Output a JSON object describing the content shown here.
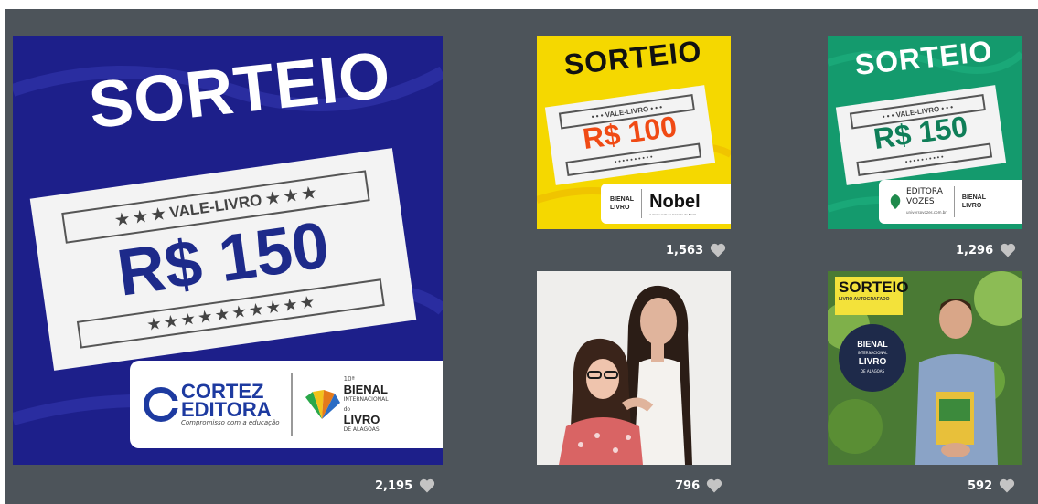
{
  "posts": [
    {
      "sorteio": "SORTEIO",
      "vale": "★ ★ ★ VALE-LIVRO ★ ★ ★",
      "amount": "R$ 150",
      "stars": "★ ★ ★ ★ ★ ★ ★ ★ ★ ★",
      "logo1_line1": "CORTEZ",
      "logo1_line2": "EDITORA",
      "logo1_tagline": "Compromisso com a educação",
      "logo2_small": "10ª",
      "logo2_line1": "BIENAL",
      "logo2_line2": "INTERNACIONAL",
      "logo2_line3": "do",
      "logo2_line4": "LIVRO",
      "logo2_line5": "DE ALAGOAS",
      "likes": "2,195"
    },
    {
      "sorteio": "SORTEIO",
      "vale": "• • • VALE-LIVRO • • •",
      "amount": "R$ 100",
      "stars": "• • • • • • • • • •",
      "logo1_line1": "BIENAL",
      "logo1_line2": "LIVRO",
      "logo2_line1": "Nobel",
      "logo2_tagline": "A maior rede de livrarias do Brasil",
      "likes": "1,563"
    },
    {
      "sorteio": "SORTEIO",
      "vale": "• • • VALE-LIVRO • • •",
      "amount": "R$ 150",
      "stars": "• • • • • • • • • •",
      "logo1_line1": "EDITORA",
      "logo1_line2": "VOZES",
      "logo1_url": "universovozes.com.br",
      "logo2_line1": "BIENAL",
      "logo2_line2": "LIVRO",
      "likes": "1,296"
    },
    {
      "likes": "796"
    },
    {
      "sorteio": "SORTEIO",
      "subtitle": "LIVRO AUTOGRAFADO",
      "badge_line1": "BIENAL",
      "badge_line2": "INTERNACIONAL",
      "badge_line3": "LIVRO",
      "badge_line4": "DE ALAGOAS",
      "likes": "592"
    }
  ],
  "colors": {
    "panel": "#4d545a",
    "blue_bg": "#1d1f8a",
    "yellow_bg": "#f5d800",
    "green_bg": "#149a6d",
    "heart": "#c4c4c4"
  },
  "icons": [
    "heart-icon"
  ]
}
